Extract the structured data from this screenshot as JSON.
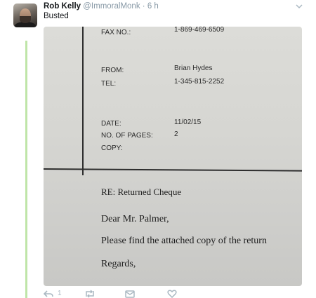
{
  "tweet": {
    "author_name": "Rob Kelly",
    "handle": "@ImmoralMonk",
    "separator": "·",
    "time": "6 h",
    "text": "Busted",
    "reply_count": "1"
  },
  "fax": {
    "fax_no_label": "FAX NO.:",
    "fax_no_value": "1-869-469-6509",
    "from_label": "FROM:",
    "from_value": "Brian Hydes",
    "tel_label": "TEL:",
    "tel_value": "1-345-815-2252",
    "date_label": "DATE:",
    "date_value": "11/02/15",
    "pages_label": "NO. OF PAGES:",
    "pages_value": "2",
    "copy_label": "COPY:",
    "re_line": "RE: Returned Cheque",
    "greeting": "Dear Mr. Palmer,",
    "body": "Please find the attached copy of the return",
    "closing": "Regards,"
  },
  "icons": [
    "chevron-down-icon",
    "reply-icon",
    "retweet-icon",
    "message-icon",
    "like-icon"
  ],
  "colors": {
    "thread_line": "#bfe5a8",
    "muted": "#8899a6",
    "icon": "#aab8c2"
  }
}
